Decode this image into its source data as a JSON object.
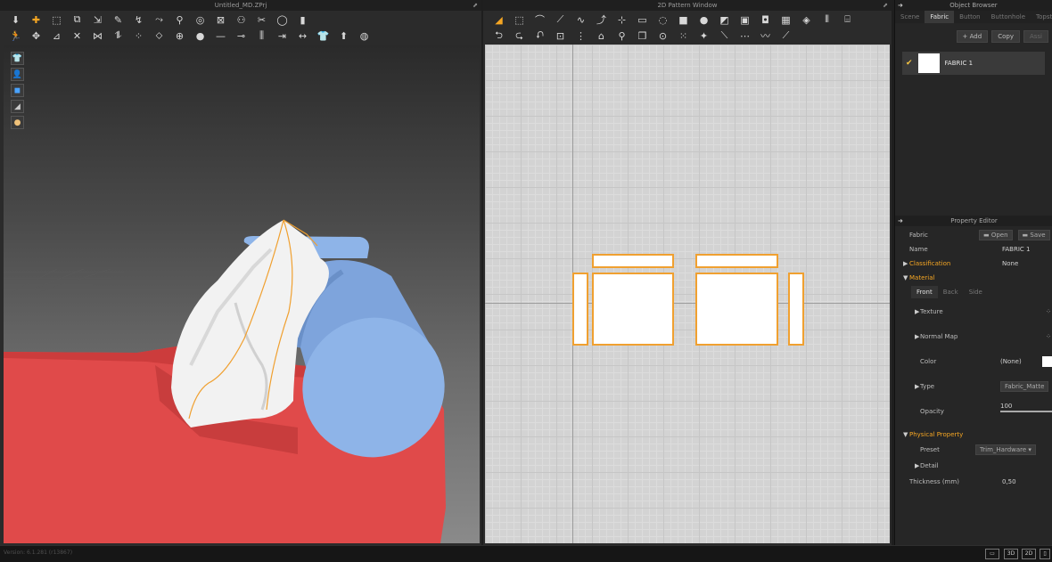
{
  "window3d": {
    "title": "Untitled_MD.ZPrj",
    "toolbar_row1": [
      "arrow-down-icon",
      "move-icon",
      "box-select-icon",
      "transform-icon",
      "edit-icon",
      "pencil-icon",
      "fold-icon",
      "avatar-move-icon",
      "pin-icon",
      "tape-icon",
      "tuck-icon",
      "pose-icon",
      "cut-icon",
      "ring-icon",
      "ruler-icon"
    ],
    "toolbar_row2": [
      "run-icon",
      "shirt-tool-icon",
      "pattern-icon",
      "stitch-icon",
      "seam-icon",
      "trim-icon",
      "dots-icon",
      "drag-icon",
      "button-icon",
      "circle-icon",
      "line-icon",
      "buttonhole-icon",
      "zipper-icon",
      "align-icon",
      "measure-icon",
      "shirt-icon",
      "shirt-fold-icon",
      "sphere-icon"
    ],
    "side_tools": [
      "shirt-view-icon",
      "avatar-view-icon",
      "fabric-view-icon",
      "shoe-view-icon",
      "head-view-icon"
    ]
  },
  "window2d": {
    "title": "2D Pattern Window",
    "toolbar_row1": [
      "triangle-select-icon",
      "edit-point-icon",
      "curve-icon",
      "segment-icon",
      "bezier-icon",
      "dot-curve-icon",
      "point-icon",
      "rect-icon",
      "ellipse-icon",
      "rect-fill-icon",
      "circle-fill-icon",
      "square-icon",
      "texture-icon",
      "clip-icon",
      "photo-icon",
      "color-icon",
      "grid-icon",
      "graph-icon"
    ],
    "toolbar_row2": [
      "sew-seg-icon",
      "sew-free-icon",
      "sew-multi-icon",
      "seam-check-icon",
      "fold-line-icon",
      "iron-icon",
      "pin-2d-icon",
      "copy-pattern-icon",
      "button-2d-icon",
      "dots-2d-icon",
      "star-icon",
      "line-2d-icon",
      "elastic-icon",
      "zigzag-icon",
      "slash-icon"
    ]
  },
  "object_browser": {
    "title": "Object Browser",
    "tabs": [
      "Scene",
      "Fabric",
      "Button",
      "Buttonhole",
      "Topstitch"
    ],
    "active_tab": "Fabric",
    "add_label": "+ Add",
    "copy_label": "Copy",
    "assign_label": "Assi",
    "fabrics": [
      {
        "name": "FABRIC 1",
        "color": "#ffffff"
      }
    ]
  },
  "property_editor": {
    "title": "Property Editor",
    "fabric_label": "Fabric",
    "open_label": "Open",
    "save_label": "Save",
    "name_label": "Name",
    "name_value": "FABRIC 1",
    "classification_label": "Classification",
    "classification_value": "None",
    "material_label": "Material",
    "sub_tabs": [
      "Front",
      "Back",
      "Side"
    ],
    "texture_label": "Texture",
    "normal_map_label": "Normal Map",
    "color_label": "Color",
    "color_value": "(None)",
    "type_label": "Type",
    "type_value": "Fabric_Matte",
    "opacity_label": "Opacity",
    "opacity_value": "100",
    "physical_property_label": "Physical Property",
    "preset_label": "Preset",
    "preset_value": "Trim_Hardware",
    "detail_label": "Detail",
    "thickness_label": "Thickness (mm)",
    "thickness_value": "0,50"
  },
  "status_bar": {
    "version": "Version: 6.1.281 (r13867)",
    "view_buttons": [
      "3D",
      "2D"
    ]
  },
  "colors": {
    "accent": "#f5a623",
    "pattern_outline": "#f0a030",
    "cushion": "#e04848",
    "bolster": "#8eb4e8",
    "fabric": "#ffffff"
  }
}
